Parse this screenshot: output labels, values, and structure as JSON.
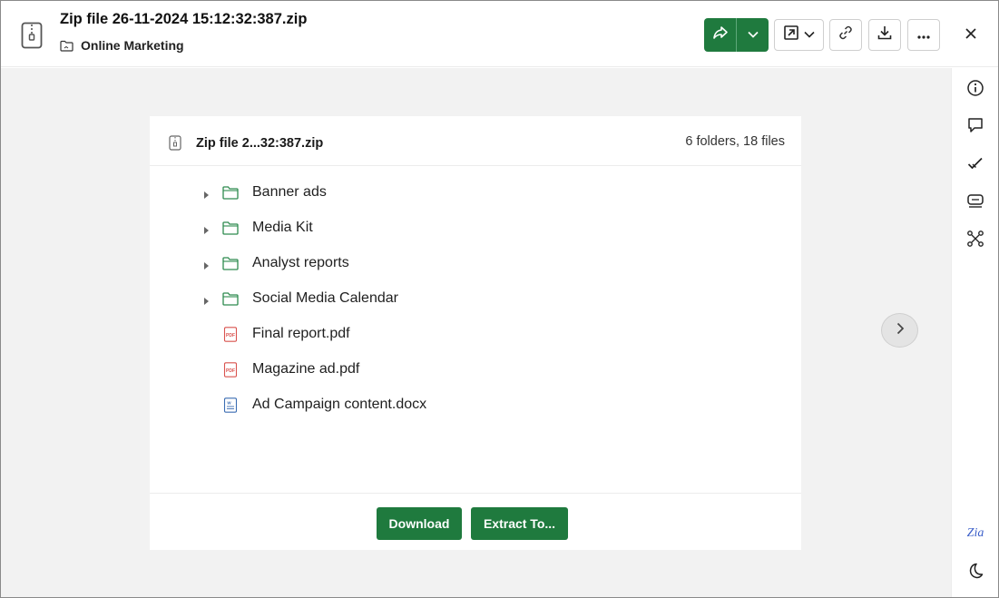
{
  "header": {
    "file_title": "Zip file 26-11-2024 15:12:32:387.zip",
    "folder_name": "Online Marketing",
    "icons": [
      "zip-file-icon",
      "folder-icon",
      "share-icon",
      "chevron-down-icon",
      "open-in-app-icon",
      "link-icon",
      "download-icon",
      "more-icon",
      "close-icon"
    ]
  },
  "card": {
    "title": "Zip file 2...32:387.zip",
    "count": "6 folders, 18 files",
    "items": [
      {
        "label": "Banner ads",
        "kind": "folder"
      },
      {
        "label": "Media Kit",
        "kind": "folder"
      },
      {
        "label": "Analyst reports",
        "kind": "folder"
      },
      {
        "label": "Social Media Calendar",
        "kind": "folder"
      },
      {
        "label": "Final report.pdf",
        "kind": "pdf"
      },
      {
        "label": "Magazine ad.pdf",
        "kind": "pdf"
      },
      {
        "label": "Ad Campaign content.docx",
        "kind": "docx"
      }
    ],
    "download_label": "Download",
    "extract_label": "Extract To..."
  },
  "rail": {
    "icons": [
      "info-icon",
      "comment-icon",
      "checkmark-icon",
      "tag-icon",
      "workflow-icon",
      "zia-icon",
      "dark-mode-icon"
    ],
    "zia_label": "Zia"
  },
  "colors": {
    "accent": "#1f7a3e",
    "folder": "#2e8b4f",
    "pdf": "#d9534f",
    "docx": "#3b6db3",
    "zia": "#3a5ec9"
  }
}
